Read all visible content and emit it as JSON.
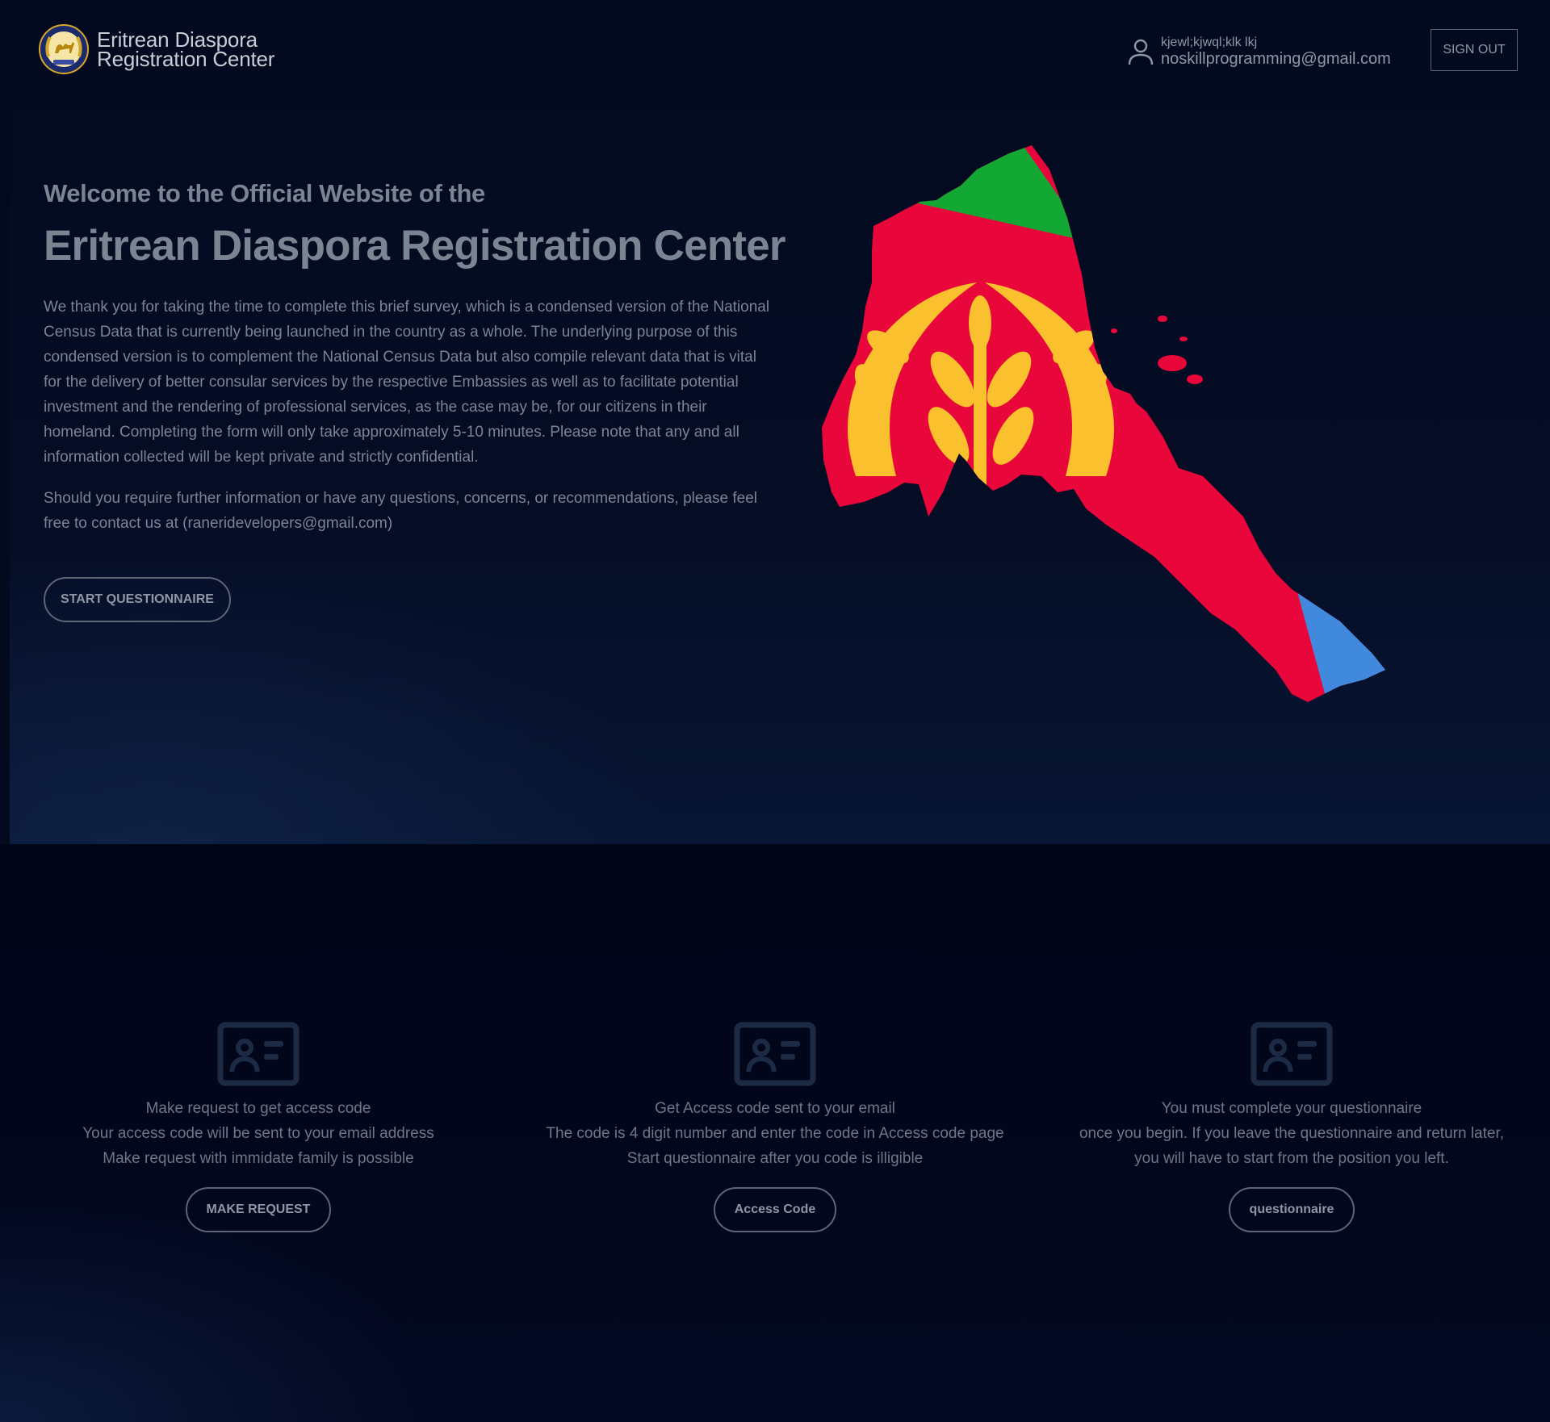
{
  "header": {
    "brand_line1": "Eritrean Diaspora",
    "brand_line2": "Registration Center",
    "user_name": "kjewl;kjwql;klk lkj",
    "user_email": "noskillprogramming@gmail.com",
    "signout_label": "SIGN OUT"
  },
  "hero": {
    "welcome": "Welcome to the Official Website of the",
    "title": "Eritrean Diaspora Registration Center",
    "paragraph1": "We thank you for taking the time to complete this brief survey, which is a condensed version of the National Census Data that is currently being launched in the country as a whole. The underlying purpose of this condensed version is to complement the National Census Data but also compile relevant data that is vital for the delivery of better consular services by the respective Embassies as well as to facilitate potential investment and the rendering of professional services, as the case may be, for our citizens in their homeland. Completing the form will only take approximately 5-10 minutes. Please note that any and all information collected will be kept private and strictly confidential.",
    "paragraph2": "Should you require further information or have any questions, concerns, or recommendations, please feel free to contact us at (ranerideveloper​s@gmail.com)",
    "start_label": "START QUESTIONNAIRE"
  },
  "cards": [
    {
      "line1": "Make request to get access code",
      "line2": "Your access code will be sent to your email address",
      "line3": "Make request with immidate family is possible",
      "button": "MAKE REQUEST"
    },
    {
      "line1": "Get Access code sent to your email",
      "line2": "The code is 4 digit number and enter the code in Access code page",
      "line3": "Start questionnaire after you code is illigible",
      "button": "Access Code"
    },
    {
      "line1": "You must complete your questionnaire",
      "line2": "once you begin. If you leave the questionnaire and return later,",
      "line3": "you will have to start from the position you left.",
      "button": "questionnaire"
    }
  ],
  "colors": {
    "flag_green": "#12a833",
    "flag_red": "#e8063a",
    "flag_blue": "#4189dd",
    "flag_yellow": "#fbc02d"
  }
}
